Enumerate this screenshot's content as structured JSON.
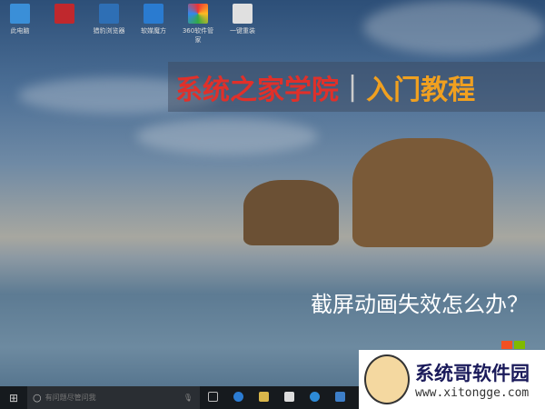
{
  "desktop": {
    "icons": [
      {
        "label": "此电脑",
        "color": "#3a8fd8"
      },
      {
        "label": "",
        "color": "#c0282d"
      },
      {
        "label": "猎豹浏览器",
        "color": "#2e6fb5"
      },
      {
        "label": "软媒魔方",
        "color": "#2a7bd0"
      },
      {
        "label": "360软件管家",
        "color": "#3aa040"
      },
      {
        "label": "一键重装",
        "color": "#e0e0e0"
      }
    ]
  },
  "banner": {
    "brand": "系统之家学院",
    "divider": "|",
    "section": "入门教程"
  },
  "headline": "截屏动画失效怎么办？",
  "taskbar": {
    "search_placeholder": "有问题尽管问我",
    "apps": [
      "task-view",
      "edge",
      "file-explorer",
      "store",
      "browser",
      "app"
    ]
  },
  "watermark": {
    "name": "系统哥软件园",
    "url": "www.xitongge.com"
  }
}
